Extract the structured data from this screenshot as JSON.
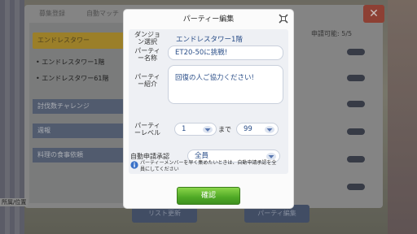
{
  "background": {
    "tabs": [
      "募集登録",
      "自動マッチ"
    ],
    "dropdown_label": "エンドレスタワー",
    "floor_items": [
      "エンドレスタワー1階",
      "エンドレスタワー61階"
    ],
    "categories": [
      "討伐数チャレンジ",
      "週報",
      "料理の食事依頼"
    ],
    "status_text": "申請可能: 5/5",
    "footer_text": "所属/位置",
    "bottom_buttons": [
      "リスト更新",
      "パーティ編集"
    ],
    "close_glyph": "✕"
  },
  "dialog": {
    "title": "パーティー編集",
    "dungeon_label": "ダンジョン選択",
    "dungeon_value": "エンドレスタワー1階",
    "party_name_label": "パーティー名称",
    "party_name_value": "ET20-50に挑戦!",
    "party_intro_label": "パーティー紹介",
    "party_intro_value": "回復の人ご協力ください!",
    "party_level_label": "パーティーレベル",
    "level_min": "1",
    "level_to": "まで",
    "level_max": "99",
    "auto_approve_label": "自動申請承認",
    "auto_approve_value": "全員",
    "info_text": "パーティーメンバーを早く集めたいときは、自動申請承認を全員にしてください",
    "confirm_label": "確認"
  },
  "colors": {
    "accent_text": "#2a4e88",
    "confirm_green": "#4fa825",
    "close_red": "#a7483a"
  },
  "icons": [
    "close-icon",
    "dropdown-caret-icon",
    "info-icon"
  ]
}
